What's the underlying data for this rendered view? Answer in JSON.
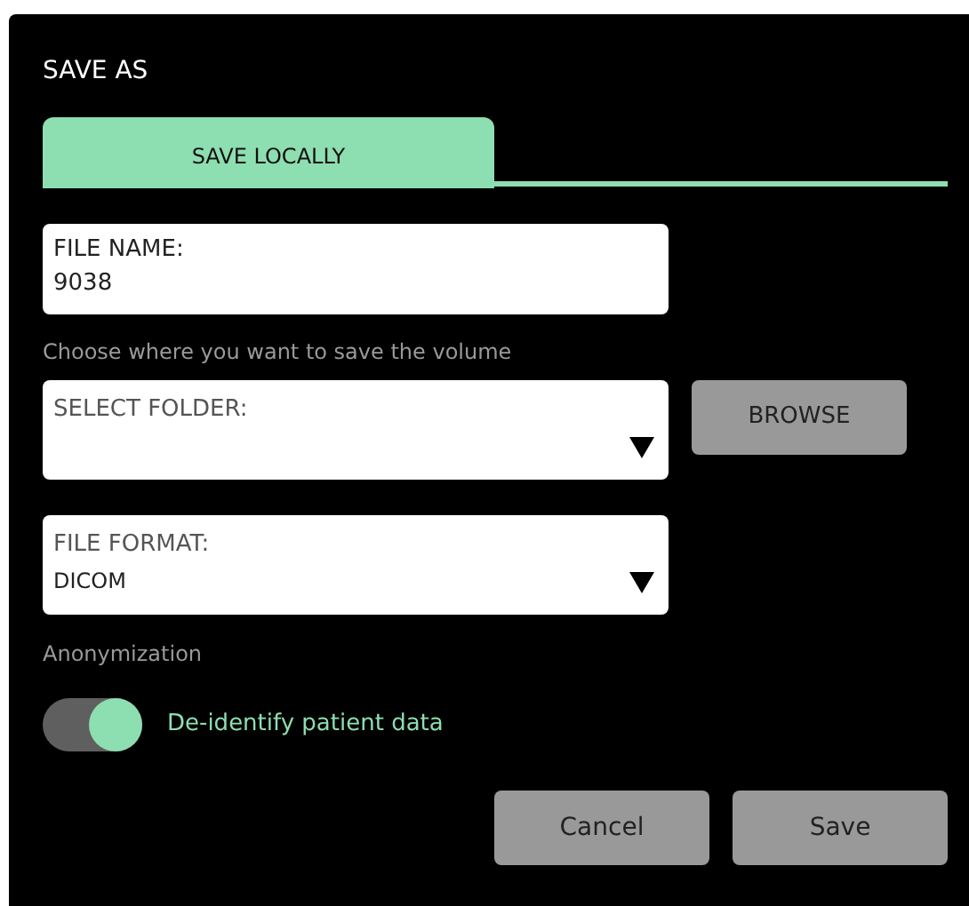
{
  "dialog": {
    "title": "SAVE AS"
  },
  "tabs": [
    {
      "label": "SAVE LOCALLY",
      "selected": true
    }
  ],
  "file_name": {
    "label": "FILE NAME:",
    "value": "9038"
  },
  "folder_hint": "Choose where you want to save the volume",
  "select_folder": {
    "label": "SELECT FOLDER:"
  },
  "browse_button": "BROWSE",
  "file_format": {
    "label": "FILE FORMAT:",
    "value": "DICOM"
  },
  "anonymization": {
    "heading": "Anonymization",
    "toggle_label": "De-identify patient data",
    "on": true
  },
  "buttons": [
    "Cancel",
    "Save"
  ]
}
